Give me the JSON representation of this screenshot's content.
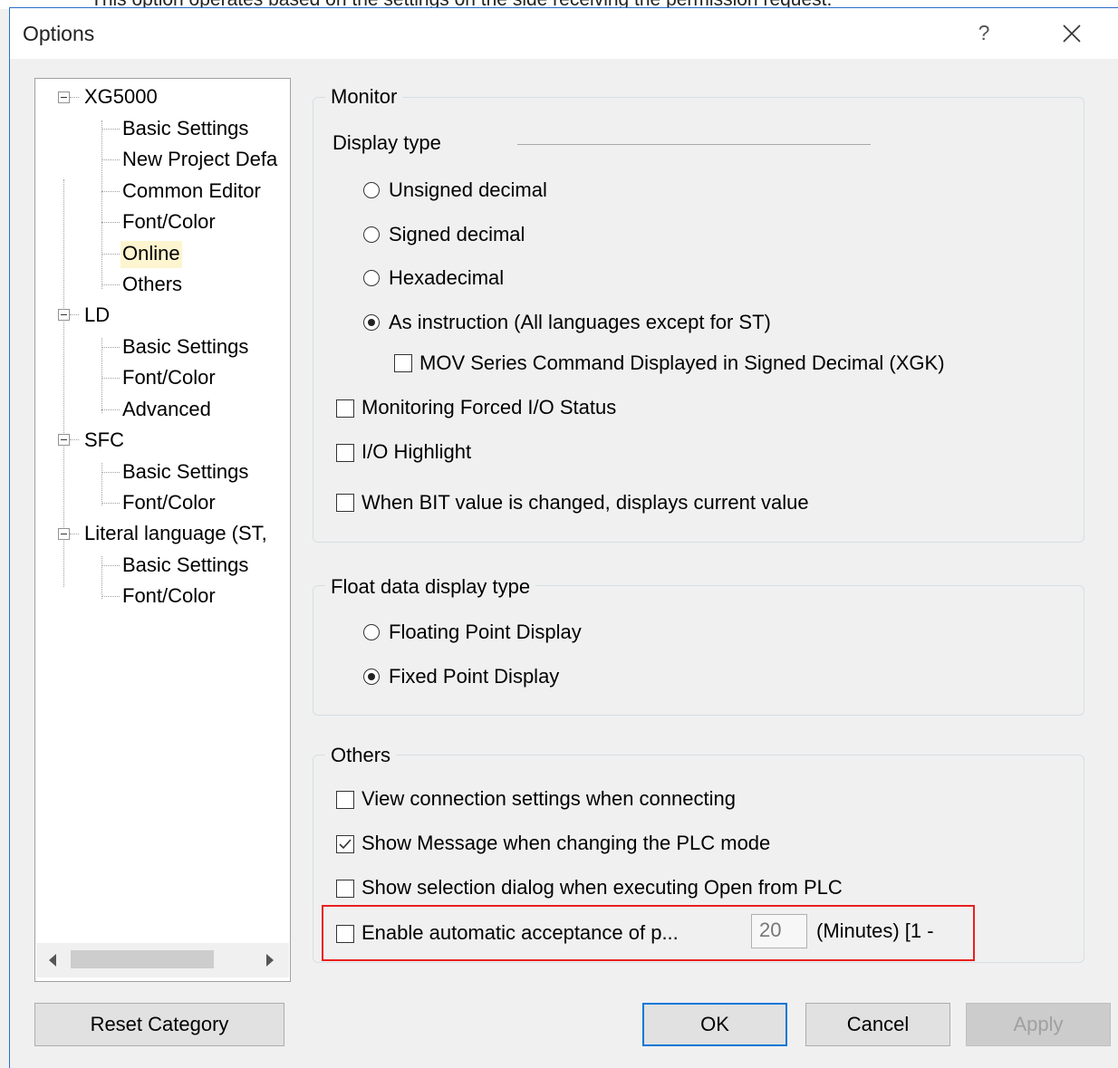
{
  "banner_text": "This option operates based on the settings on the side receiving the permission request.",
  "window": {
    "title": "Options",
    "help_label": "?"
  },
  "tree": {
    "roots": [
      {
        "label": "XG5000",
        "children": [
          "Basic Settings",
          "New Project Defa",
          "Common Editor",
          "Font/Color",
          "Online",
          "Others"
        ]
      },
      {
        "label": "LD",
        "children": [
          "Basic Settings",
          "Font/Color",
          "Advanced"
        ]
      },
      {
        "label": "SFC",
        "children": [
          "Basic Settings",
          "Font/Color"
        ]
      },
      {
        "label": "Literal language (ST,",
        "children": [
          "Basic Settings",
          "Font/Color"
        ]
      }
    ],
    "selected": "Online"
  },
  "monitor": {
    "title": "Monitor",
    "display_type_label": "Display type",
    "radios": [
      {
        "label": "Unsigned decimal",
        "checked": false
      },
      {
        "label": "Signed decimal",
        "checked": false
      },
      {
        "label": "Hexadecimal",
        "checked": false
      },
      {
        "label": "As instruction (All languages except for ST)",
        "checked": true
      }
    ],
    "mov_checkbox": {
      "label": "MOV Series Command Displayed in Signed Decimal (XGK)",
      "checked": false
    },
    "checkboxes": [
      {
        "label": "Monitoring Forced I/O Status",
        "checked": false
      },
      {
        "label": "I/O Highlight",
        "checked": false
      },
      {
        "label": "When BIT value is changed, displays current value",
        "checked": false
      }
    ]
  },
  "float": {
    "title": "Float data display type",
    "radios": [
      {
        "label": "Floating Point Display",
        "checked": false
      },
      {
        "label": "Fixed Point Display",
        "checked": true
      }
    ]
  },
  "others": {
    "title": "Others",
    "checkboxes": [
      {
        "label": "View connection settings when connecting",
        "checked": false
      },
      {
        "label": "Show Message when changing the PLC mode",
        "checked": true
      },
      {
        "label": "Show selection dialog when executing Open from PLC",
        "checked": false
      }
    ],
    "auto_accept": {
      "label": "Enable automatic acceptance of p...",
      "checked": false,
      "value": "20",
      "unit": "(Minutes) [1 -"
    }
  },
  "buttons": {
    "reset": "Reset Category",
    "ok": "OK",
    "cancel": "Cancel",
    "apply": "Apply"
  },
  "colors": {
    "highlight": "#e8201e",
    "selection": "#fdf5cf",
    "accent": "#0078d7"
  }
}
